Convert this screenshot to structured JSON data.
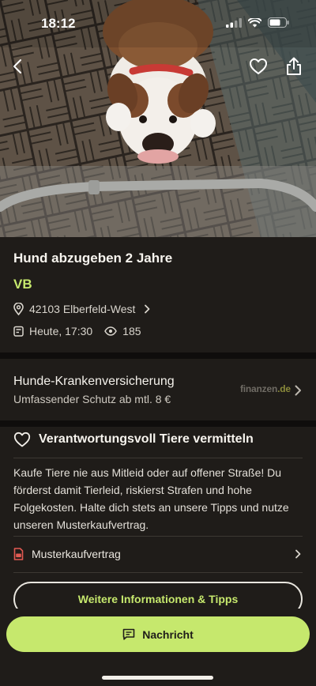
{
  "status_bar": {
    "time": "18:12"
  },
  "listing": {
    "title": "Hund abzugeben 2 Jahre",
    "price": "VB",
    "location": "42103 Elberfeld-West",
    "date": "Heute, 17:30",
    "views": "185"
  },
  "ad": {
    "title": "Hunde-Krankenversicherung",
    "subtitle": "Umfassender Schutz ab mtl. 8 €",
    "logo_main": "finanzen",
    "logo_suffix": ".de"
  },
  "info": {
    "title": "Verantwortungsvoll Tiere vermitteln",
    "body": "Kaufe Tiere nie aus Mitleid oder auf offener Straße! Du förderst damit Tierleid, riskierst Strafen und hohe Folgekosten. Halte dich stets an unsere Tipps und nutze unseren Musterkaufvertrag.",
    "contract_label": "Musterkaufvertrag",
    "more_button": "Weitere Informationen & Tipps"
  },
  "bottom": {
    "message_button": "Nachricht"
  },
  "colors": {
    "accent": "#c6e86d",
    "background": "#1f1c19",
    "pdf_icon": "#e25a52"
  }
}
